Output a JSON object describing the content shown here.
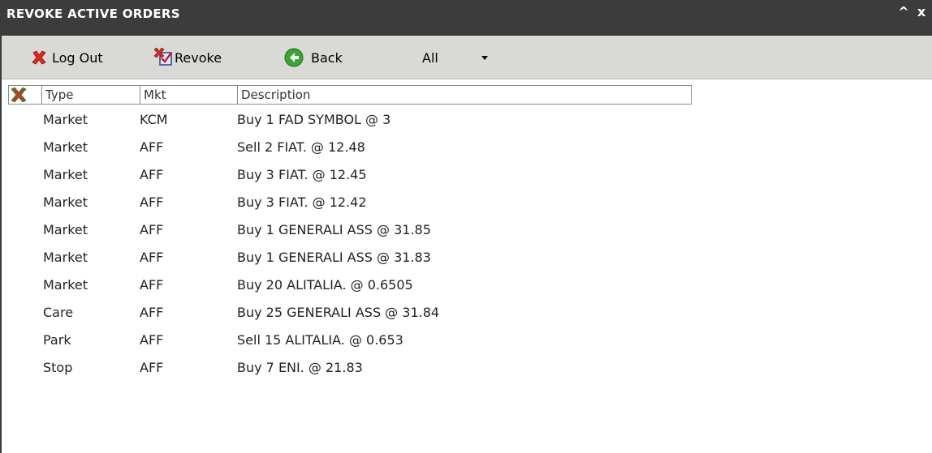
{
  "window": {
    "title": "REVOKE ACTIVE ORDERS",
    "minimize_glyph": "^",
    "close_glyph": "x"
  },
  "toolbar": {
    "logout_label": "Log Out",
    "revoke_label": "Revoke",
    "back_label": "Back",
    "filter_value": "All"
  },
  "icons": {
    "logout": "red-x-icon",
    "revoke": "revoke-order-icon",
    "back": "green-back-arrow-icon",
    "header": "revoke-all-icon"
  },
  "colors": {
    "titlebar": "#3c3c3c",
    "toolbar": "#d9d9d6",
    "logout_red": "#e0281c",
    "back_green": "#3aa534"
  },
  "grid": {
    "columns": [
      "Type",
      "Mkt",
      "Description"
    ],
    "rows": [
      {
        "type": "Market",
        "mkt": "KCM",
        "description": "Buy 1 FAD SYMBOL @ 3"
      },
      {
        "type": "Market",
        "mkt": "AFF",
        "description": "Sell 2 FIAT. @ 12.48"
      },
      {
        "type": "Market",
        "mkt": "AFF",
        "description": "Buy 3 FIAT. @ 12.45"
      },
      {
        "type": "Market",
        "mkt": "AFF",
        "description": "Buy 3 FIAT. @ 12.42"
      },
      {
        "type": "Market",
        "mkt": "AFF",
        "description": "Buy 1 GENERALI ASS @ 31.85"
      },
      {
        "type": "Market",
        "mkt": "AFF",
        "description": "Buy 1 GENERALI ASS @ 31.83"
      },
      {
        "type": "Market",
        "mkt": "AFF",
        "description": "Buy 20 ALITALIA. @ 0.6505"
      },
      {
        "type": "Care",
        "mkt": "AFF",
        "description": "Buy 25 GENERALI ASS @ 31.84"
      },
      {
        "type": "Park",
        "mkt": "AFF",
        "description": "Sell 15 ALITALIA. @ 0.653"
      },
      {
        "type": "Stop",
        "mkt": "AFF",
        "description": "Buy 7 ENI. @ 21.83"
      }
    ]
  }
}
